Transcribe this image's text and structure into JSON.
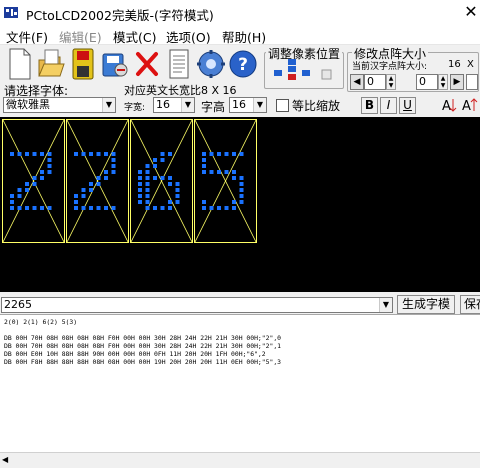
{
  "window": {
    "title": "PCtoLCD2002完美版-(字符模式)"
  },
  "menu": {
    "items": [
      {
        "label": "文件(F)"
      },
      {
        "label": "编辑(E)"
      },
      {
        "label": "模式(C)"
      },
      {
        "label": "选项(O)"
      },
      {
        "label": "帮助(H)"
      }
    ]
  },
  "toolbar": {
    "icons": [
      "new-file-icon",
      "open-folder-icon",
      "save-icon",
      "save-as-icon",
      "delete-icon",
      "notepad-icon",
      "settings-gear-icon",
      "help-icon"
    ],
    "adjust_group_title": "调整像素位置",
    "dot_size_group_title": "修改点阵大小",
    "dot_size_caption": "当前汉字点阵大小:",
    "dot_size_value": "16",
    "dot_size_x": "X",
    "spin_left_value": "0",
    "spin_right_value": "0"
  },
  "font": {
    "select_label": "请选择字体:",
    "font_name": "微软雅黑",
    "width_caption": "对应英文长宽比8 X 16",
    "char_width_label": "字宽:",
    "char_width_value": "16",
    "char_height_label": "字高",
    "char_height_value": "16",
    "proportional_label": "等比缩放",
    "bold": "B",
    "italic": "I",
    "underline": "U"
  },
  "preview": {
    "chars": [
      "2",
      "2",
      "6",
      "5"
    ],
    "dot_color": "#1a72ff",
    "frame_color": "#ffff66"
  },
  "input": {
    "text": "2265",
    "generate_button": "生成字模",
    "save_button": "保存"
  },
  "output": {
    "index_line": "2(0) 2(1) 6(2) 5(3)",
    "rows": [
      "DB 00H 70H 08H 08H 08H 08H F0H 00H 00H 30H 28H 24H 22H 21H 30H 00H;\"2\",0",
      "DB 00H 70H 08H 08H 08H 08H F0H 00H 00H 30H 28H 24H 22H 21H 30H 00H;\"2\",1",
      "DB 00H E0H 10H 88H 88H 90H 00H 00H 00H 0FH 11H 20H 20H 1FH 00H;\"6\",2",
      "DB 00H F8H 88H 88H 88H 08H 08H 00H 00H 19H 20H 20H 20H 11H 0EH 00H;\"5\",3"
    ]
  }
}
